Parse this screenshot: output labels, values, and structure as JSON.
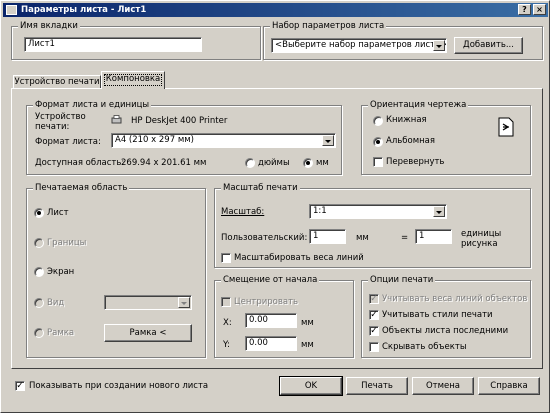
{
  "window": {
    "title": "Параметры листа - Лист1",
    "help_btn": "?",
    "close_btn": "×"
  },
  "layout_name": {
    "legend": "Имя вкладки",
    "value": "Лист1"
  },
  "page_setup": {
    "legend": "Набор параметров листа",
    "selected": "<Выберите набор параметров листа>",
    "add_button": "Добавить..."
  },
  "tabs": [
    {
      "label": "Устройство печати",
      "active": false
    },
    {
      "label": "Компоновка",
      "active": true
    }
  ],
  "paper": {
    "legend": "Формат листа и единицы",
    "device_label_1": "Устройство",
    "device_label_2": "печати:",
    "device_value": "HP DeskJet 400 Printer",
    "format_label": "Формат листа:",
    "format_value": "A4 (210 x 297 мм)",
    "area_label": "Доступная область:",
    "area_value": "269.94 x 201.61 мм",
    "units": [
      "дюймы",
      "мм"
    ],
    "units_selected": "мм"
  },
  "orientation": {
    "legend": "Ориентация чертежа",
    "portrait": "Книжная",
    "landscape": "Альбомная",
    "selected": "Альбомная",
    "flip": "Перевернуть",
    "flip_checked": false,
    "icon": "landscape-page-icon"
  },
  "print_area": {
    "legend": "Печатаемая область",
    "options": [
      {
        "label": "Лист",
        "selected": true,
        "enabled": true
      },
      {
        "label": "Границы",
        "selected": false,
        "enabled": false
      },
      {
        "label": "Экран",
        "selected": false,
        "enabled": true
      },
      {
        "label": "Вид",
        "selected": false,
        "enabled": false
      },
      {
        "label": "Рамка",
        "selected": false,
        "enabled": false
      }
    ],
    "view_combo_value": "",
    "window_button": "Рамка <"
  },
  "scale": {
    "legend": "Масштаб печати",
    "scale_label": "Масштаб:",
    "scale_value": "1:1",
    "custom_label": "Пользовательский:",
    "custom_mm_value": "1",
    "custom_mm_unit": "мм",
    "equals": "=",
    "custom_units_value": "1",
    "custom_units_label_1": "единицы",
    "custom_units_label_2": "рисунка",
    "lineweights_label": "Масштабировать веса линий",
    "lineweights_checked": false
  },
  "offset": {
    "legend": "Смещение от начала",
    "center_label": "Центрировать",
    "center_checked": false,
    "x_label": "X:",
    "x_value": "0.00",
    "y_label": "Y:",
    "y_value": "0.00",
    "unit": "мм"
  },
  "options": {
    "legend": "Опции печати",
    "items": [
      {
        "label": "Учитывать веса линий объектов",
        "checked": true,
        "enabled": false
      },
      {
        "label": "Учитывать стили печати",
        "checked": true,
        "enabled": true
      },
      {
        "label": "Объекты листа последними",
        "checked": true,
        "enabled": true
      },
      {
        "label": "Скрывать объекты",
        "checked": false,
        "enabled": true
      }
    ]
  },
  "footer": {
    "show_on_new": "Показывать при создании нового листа",
    "show_on_new_checked": true,
    "ok": "OK",
    "plot": "Печать",
    "cancel": "Отмена",
    "help": "Справка"
  },
  "colors": {
    "face": "#d4d0c8",
    "title_start": "#0a246a",
    "title_end": "#3a6ea5"
  }
}
